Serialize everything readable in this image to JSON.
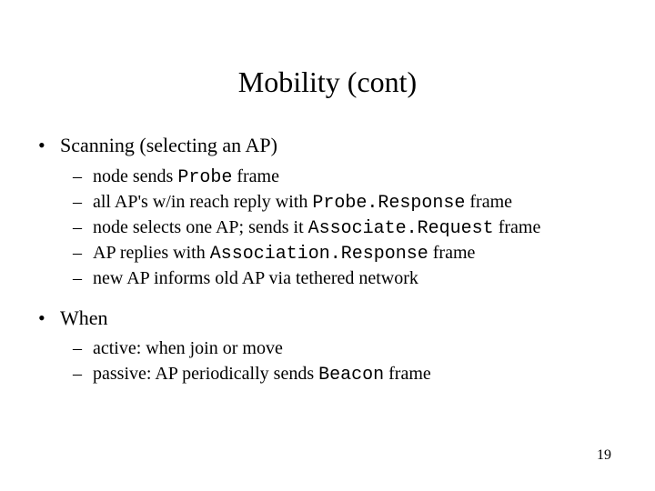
{
  "title": "Mobility (cont)",
  "page_number": "19",
  "bullets": [
    {
      "label": "Scanning (selecting an AP)",
      "sub": [
        {
          "pre": "node sends ",
          "code": "Probe",
          "post": " frame"
        },
        {
          "pre": "all AP's w/in reach reply with ",
          "code": "Probe.Response",
          "post": " frame"
        },
        {
          "pre": "node selects one AP; sends it ",
          "code": "Associate.Request",
          "post": " frame"
        },
        {
          "pre": "AP replies with ",
          "code": "Association.Response",
          "post": " frame"
        },
        {
          "pre": "new AP informs old AP via tethered network",
          "code": "",
          "post": ""
        }
      ]
    },
    {
      "label": "When",
      "sub": [
        {
          "pre": "active: when join or move",
          "code": "",
          "post": ""
        },
        {
          "pre": "passive: AP periodically sends ",
          "code": "Beacon",
          "post": " frame"
        }
      ]
    }
  ]
}
